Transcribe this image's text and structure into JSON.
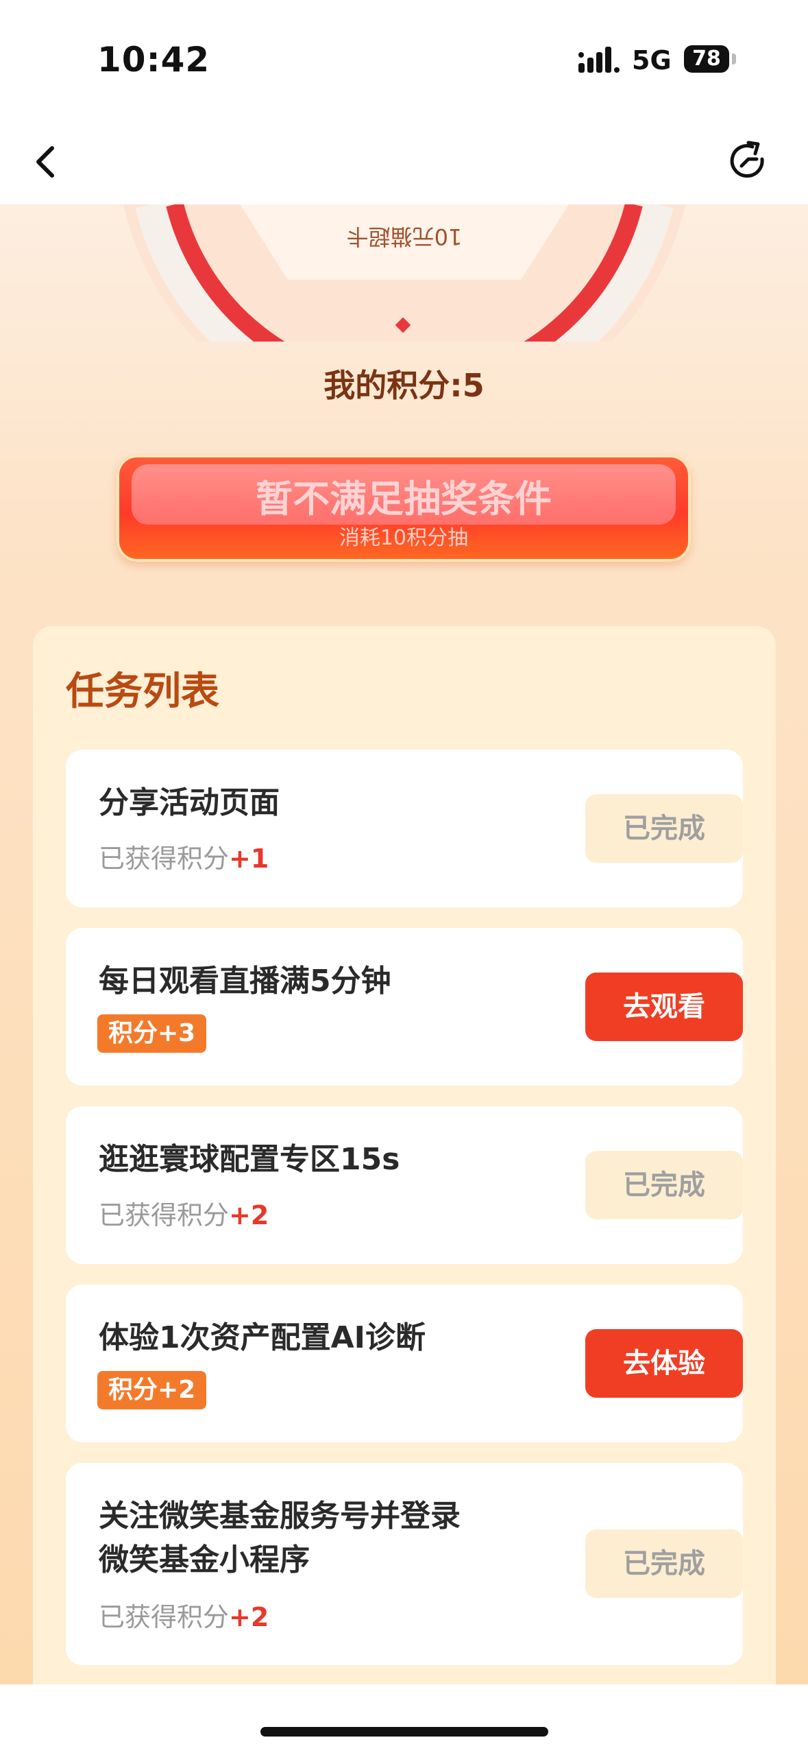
{
  "status_bar": {
    "time": "10:42",
    "network": "5G",
    "battery": "78"
  },
  "nav": {
    "back_icon": "chevron-left-icon",
    "refresh_icon": "refresh-icon"
  },
  "wheel": {
    "prize_text": "10元猫超卡"
  },
  "points": {
    "label": "我的积分:5"
  },
  "draw_button": {
    "title": "暂不满足抽奖条件",
    "subtitle": "消耗10积分抽"
  },
  "task_panel": {
    "title": "任务列表",
    "tasks": [
      {
        "name_line1": "分享活动页面",
        "earned_prefix": "已获得积分",
        "earned_value": "+1",
        "button": "已完成"
      },
      {
        "name_line1": "每日观看直播满5分钟",
        "badge": "积分+3",
        "button": "去观看"
      },
      {
        "name_line1": "逛逛寰球配置专区15s",
        "earned_prefix": "已获得积分",
        "earned_value": "+2",
        "button": "已完成"
      },
      {
        "name_line1": "体验1次资产配置AI诊断",
        "badge": "积分+2",
        "button": "去体验"
      },
      {
        "name_line1": "关注微笑基金服务号并登录",
        "name_line2": "微笑基金小程序",
        "earned_prefix": "已获得积分",
        "earned_value": "+2",
        "button": "已完成"
      }
    ]
  },
  "colors": {
    "accent_red": "#ef3e24",
    "badge_orange": "#f47a2b",
    "title_brown": "#b84a12"
  }
}
